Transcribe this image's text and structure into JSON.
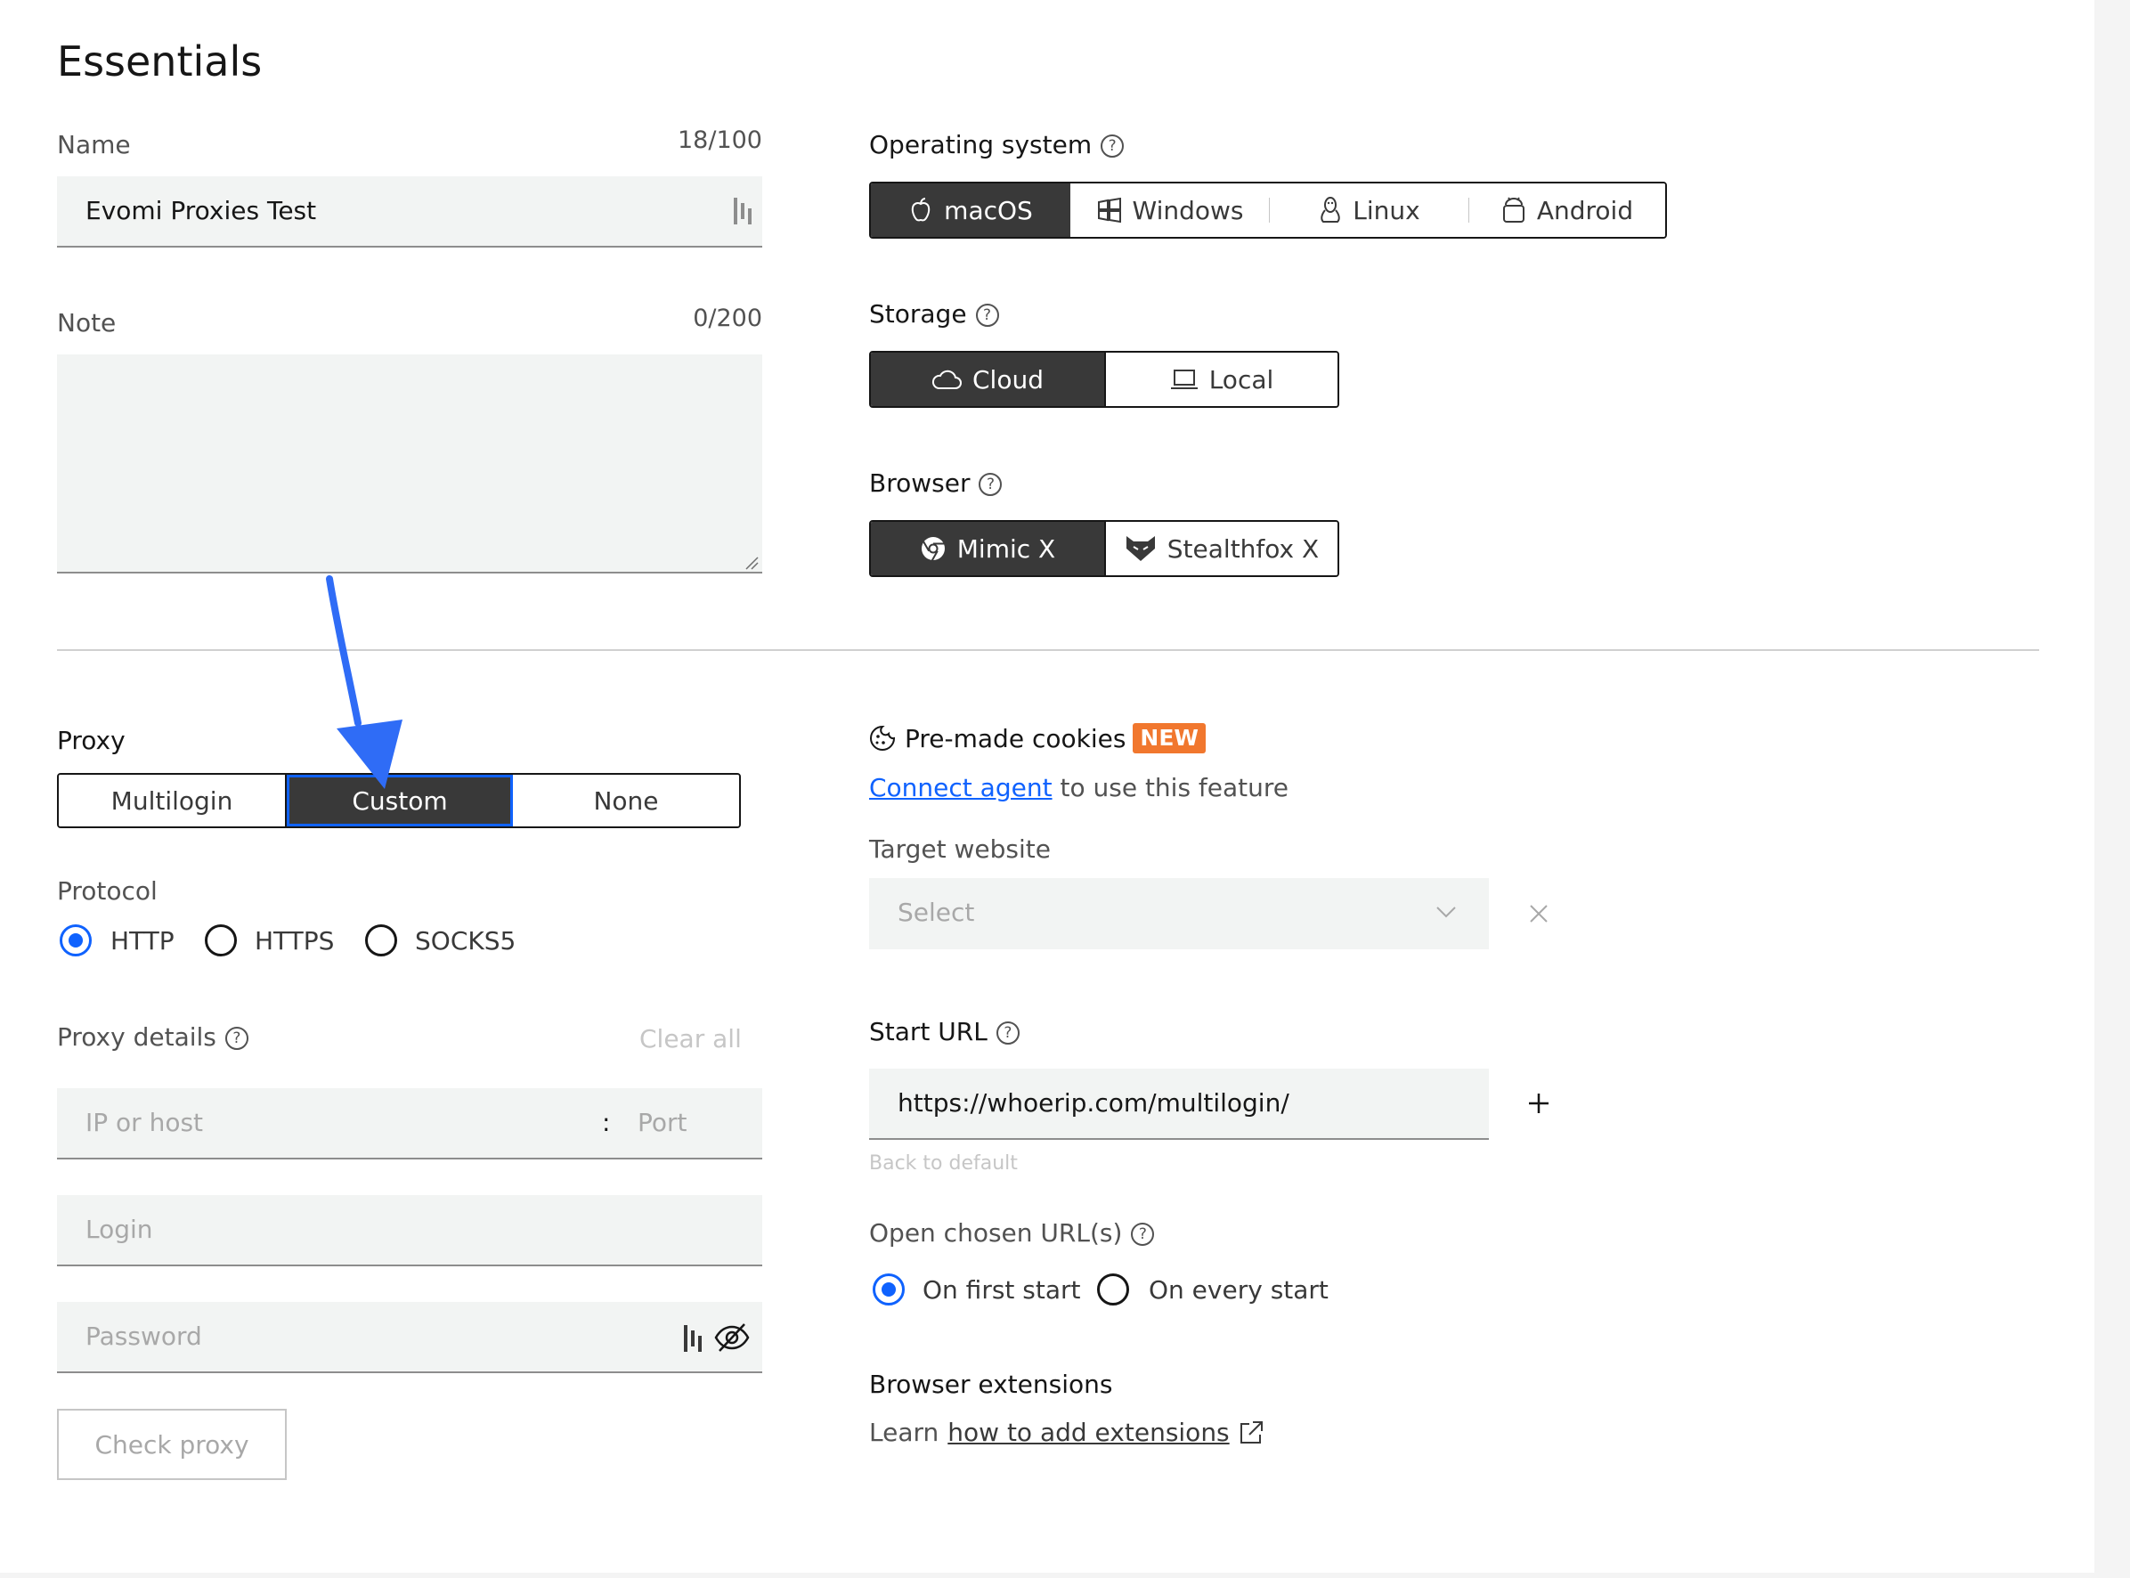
{
  "header": {
    "title": "Essentials"
  },
  "name_field": {
    "label": "Name",
    "counter": "18/100",
    "value": "Evomi Proxies Test"
  },
  "note_field": {
    "label": "Note",
    "counter": "0/200",
    "value": ""
  },
  "os": {
    "label": "Operating system",
    "options": [
      "macOS",
      "Windows",
      "Linux",
      "Android"
    ],
    "selected": "macOS"
  },
  "storage": {
    "label": "Storage",
    "options": [
      "Cloud",
      "Local"
    ],
    "selected": "Cloud"
  },
  "browser": {
    "label": "Browser",
    "options": [
      "Mimic X",
      "Stealthfox X"
    ],
    "selected": "Mimic X"
  },
  "proxy": {
    "label": "Proxy",
    "options": [
      "Multilogin",
      "Custom",
      "None"
    ],
    "selected": "Custom"
  },
  "protocol": {
    "label": "Protocol",
    "options": [
      "HTTP",
      "HTTPS",
      "SOCKS5"
    ],
    "selected": "HTTP"
  },
  "proxy_details": {
    "label": "Proxy details",
    "clear_all": "Clear all",
    "host_placeholder": "IP or host",
    "separator": ":",
    "port_placeholder": "Port",
    "login_placeholder": "Login",
    "password_placeholder": "Password",
    "check_button": "Check proxy"
  },
  "cookies": {
    "title": "Pre-made cookies",
    "badge": "NEW",
    "connect_link": "Connect agent",
    "connect_suffix": "to use this feature",
    "target_label": "Target website",
    "target_placeholder": "Select"
  },
  "start_url": {
    "label": "Start URL",
    "value": "https://whoerip.com/multilogin/",
    "back_to_default": "Back to default"
  },
  "open_urls": {
    "label": "Open chosen URL(s)",
    "options": [
      "On first start",
      "On every start"
    ],
    "selected": "On first start"
  },
  "extensions": {
    "label": "Browser extensions",
    "learn_prefix": "Learn",
    "learn_link": "how to add extensions"
  },
  "colors": {
    "accent": "#0f62fe",
    "selected_segment": "#393939",
    "badge": "#f1772e",
    "annotation_arrow": "#2f6cf6"
  }
}
